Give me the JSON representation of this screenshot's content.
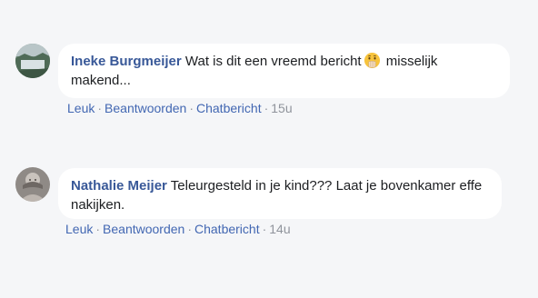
{
  "comments": [
    {
      "author": "Ineke Burgmeijer",
      "text_before_emoji": "Wat is dit een vreemd bericht",
      "emoji": "face-with-hand-over-mouth-icon",
      "text_after_emoji": "misselijk makend...",
      "actions": {
        "like": "Leuk",
        "reply": "Beantwoorden",
        "message": "Chatbericht",
        "time": "15u"
      }
    },
    {
      "author": "Nathalie Meijer",
      "text": "Teleurgesteld in je kind??? Laat je bovenkamer effe nakijken.",
      "actions": {
        "like": "Leuk",
        "reply": "Beantwoorden",
        "message": "Chatbericht",
        "time": "14u"
      }
    }
  ],
  "separator": "·",
  "colors": {
    "background": "#f5f6f8",
    "bubble": "#ffffff",
    "author": "#385898",
    "action_link": "#4267b2",
    "meta": "#90949c"
  }
}
